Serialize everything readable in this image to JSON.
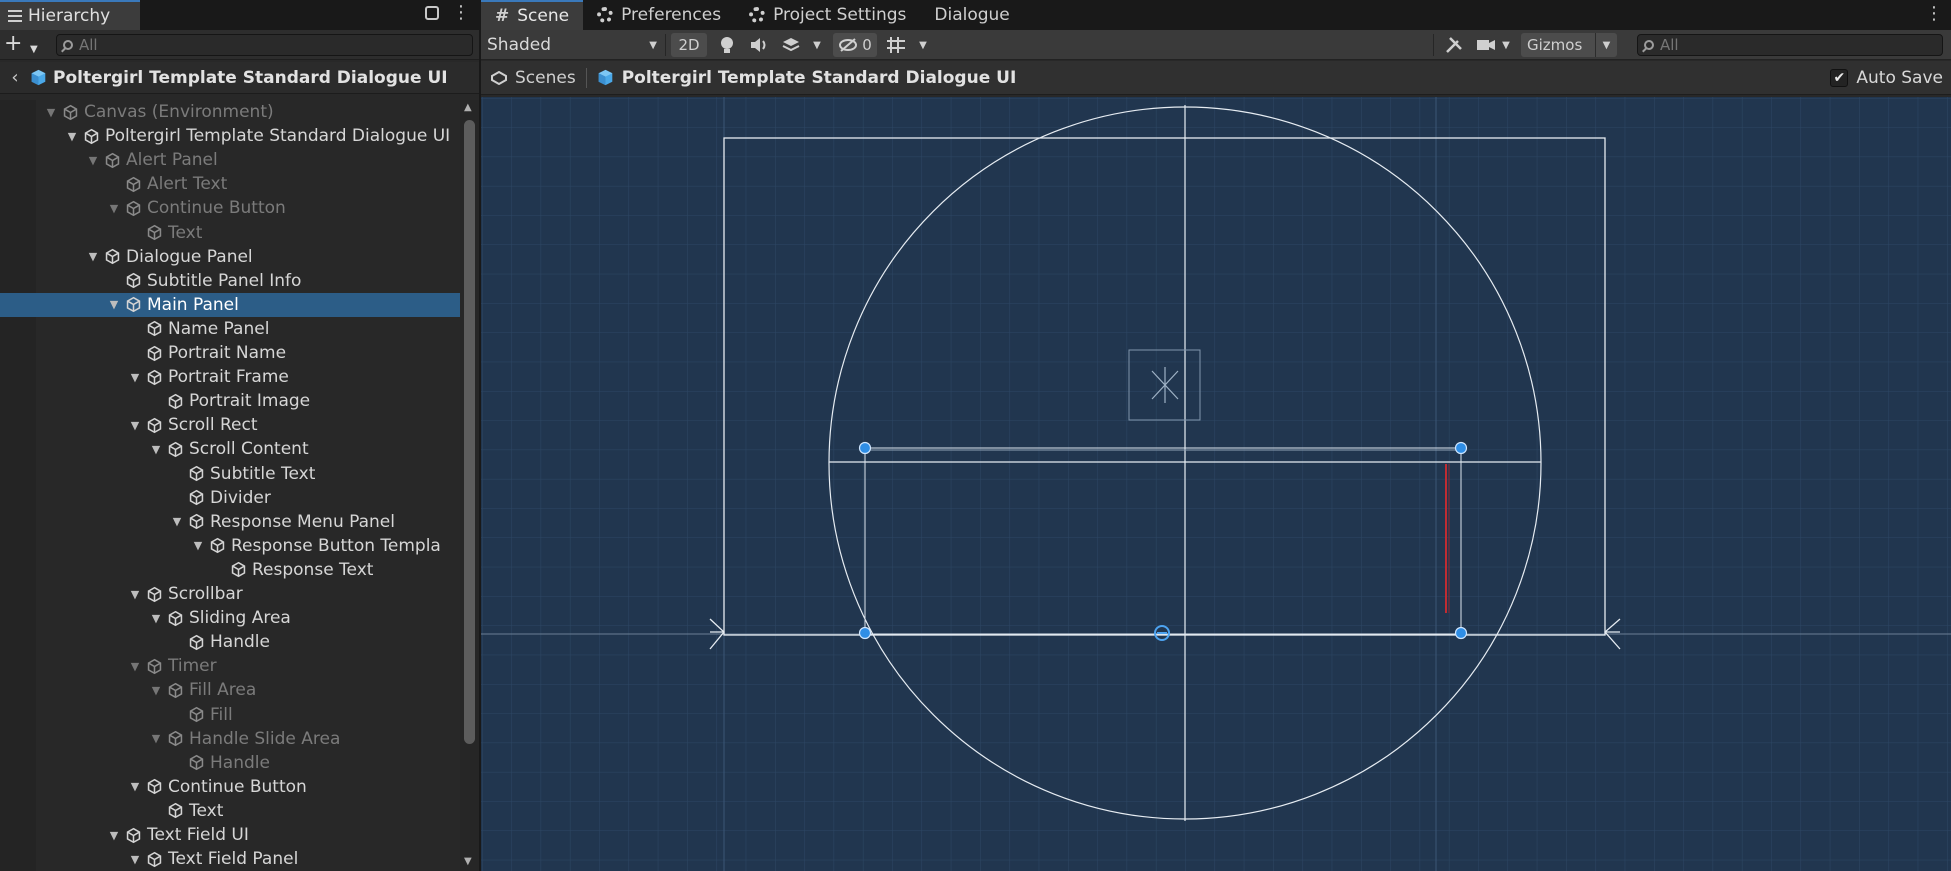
{
  "hierarchy": {
    "tab_label": "Hierarchy",
    "search_placeholder": "All",
    "breadcrumb": "Poltergirl Template Standard Dialogue UI",
    "items": [
      {
        "label": "Canvas (Environment)",
        "depth": 0,
        "expanded": true,
        "dim": true
      },
      {
        "label": "Poltergirl Template Standard Dialogue UI",
        "depth": 1,
        "expanded": true
      },
      {
        "label": "Alert Panel",
        "depth": 2,
        "expanded": true,
        "dim": true
      },
      {
        "label": "Alert Text",
        "depth": 3,
        "dim": true
      },
      {
        "label": "Continue Button",
        "depth": 3,
        "expanded": true,
        "dim": true
      },
      {
        "label": "Text",
        "depth": 4,
        "dim": true
      },
      {
        "label": "Dialogue Panel",
        "depth": 2,
        "expanded": true
      },
      {
        "label": "Subtitle Panel Info",
        "depth": 3
      },
      {
        "label": "Main Panel",
        "depth": 3,
        "expanded": true,
        "selected": true
      },
      {
        "label": "Name Panel",
        "depth": 4
      },
      {
        "label": "Portrait Name",
        "depth": 4
      },
      {
        "label": "Portrait Frame",
        "depth": 4,
        "expanded": true
      },
      {
        "label": "Portrait Image",
        "depth": 5
      },
      {
        "label": "Scroll Rect",
        "depth": 4,
        "expanded": true
      },
      {
        "label": "Scroll Content",
        "depth": 5,
        "expanded": true
      },
      {
        "label": "Subtitle Text",
        "depth": 6
      },
      {
        "label": "Divider",
        "depth": 6
      },
      {
        "label": "Response Menu Panel",
        "depth": 6,
        "expanded": true
      },
      {
        "label": "Response Button Templa",
        "depth": 7,
        "expanded": true
      },
      {
        "label": "Response Text",
        "depth": 8
      },
      {
        "label": "Scrollbar",
        "depth": 4,
        "expanded": true
      },
      {
        "label": "Sliding Area",
        "depth": 5,
        "expanded": true
      },
      {
        "label": "Handle",
        "depth": 6
      },
      {
        "label": "Timer",
        "depth": 4,
        "expanded": true,
        "dim": true
      },
      {
        "label": "Fill Area",
        "depth": 5,
        "expanded": true,
        "dim": true
      },
      {
        "label": "Fill",
        "depth": 6,
        "dim": true
      },
      {
        "label": "Handle Slide Area",
        "depth": 5,
        "expanded": true,
        "dim": true
      },
      {
        "label": "Handle",
        "depth": 6,
        "dim": true
      },
      {
        "label": "Continue Button",
        "depth": 4,
        "expanded": true
      },
      {
        "label": "Text",
        "depth": 5
      },
      {
        "label": "Text Field UI",
        "depth": 3,
        "expanded": true
      },
      {
        "label": "Text Field Panel",
        "depth": 4,
        "expanded": true
      }
    ]
  },
  "scene": {
    "tabs": [
      {
        "label": "Scene",
        "icon": "hash-icon",
        "active": true
      },
      {
        "label": "Preferences",
        "icon": "gear-icon"
      },
      {
        "label": "Project Settings",
        "icon": "gear-icon"
      },
      {
        "label": "Dialogue",
        "icon": ""
      }
    ],
    "toolbar": {
      "draw_mode": "Shaded",
      "mode_2d": "2D",
      "hidden_count": "0",
      "gizmos": "Gizmos",
      "search_placeholder": "All"
    },
    "breadcrumbs": [
      "Scenes",
      "Poltergirl Template Standard Dialogue UI"
    ],
    "auto_save_label": "Auto Save",
    "auto_save_checked": true
  },
  "colors": {
    "viewport_bg": "#21364f",
    "selection": "#2c5d87",
    "accent": "#3a79bb",
    "handle_blue": "#2f8ee6"
  }
}
